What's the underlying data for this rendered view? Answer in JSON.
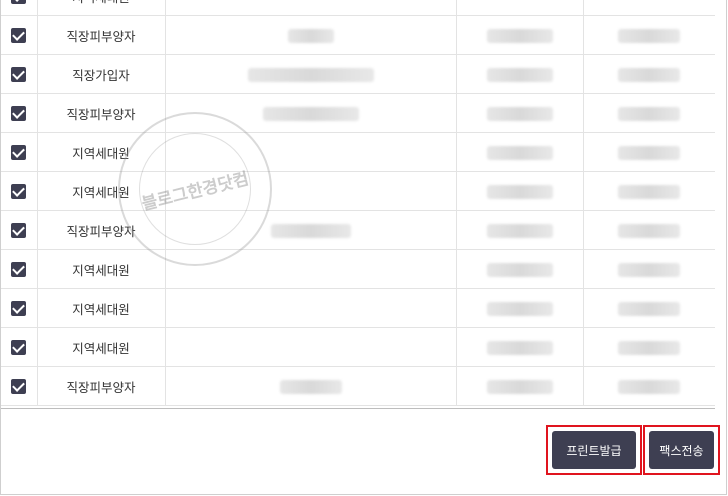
{
  "rows": [
    {
      "type": "지역세대원",
      "checked": true
    },
    {
      "type": "직장피부양자",
      "checked": true
    },
    {
      "type": "직장가입자",
      "checked": true
    },
    {
      "type": "직장피부양자",
      "checked": true
    },
    {
      "type": "지역세대원",
      "checked": true
    },
    {
      "type": "지역세대원",
      "checked": true
    },
    {
      "type": "직장피부양자",
      "checked": true
    },
    {
      "type": "지역세대원",
      "checked": true
    },
    {
      "type": "지역세대원",
      "checked": true
    },
    {
      "type": "지역세대원",
      "checked": true
    },
    {
      "type": "직장피부양자",
      "checked": true
    }
  ],
  "buttons": {
    "print_label": "프린트발급",
    "fax_label": "팩스전송"
  },
  "watermark": {
    "text": "블로그한경닷컴"
  },
  "colors": {
    "checkbox": "#3e3f52",
    "button_bg": "#3e3f52",
    "highlight": "#e0141e"
  }
}
